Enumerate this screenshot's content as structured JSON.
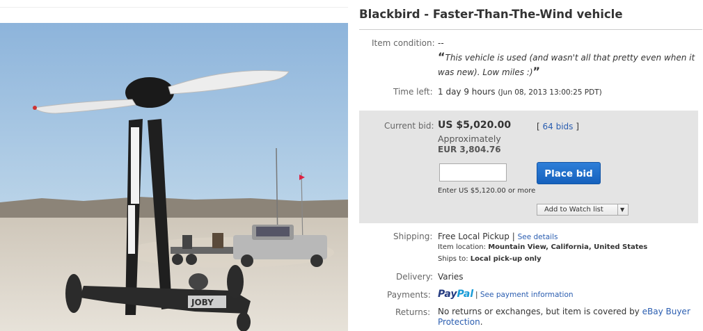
{
  "listing": {
    "title": "Blackbird - Faster-Than-The-Wind vehicle"
  },
  "condition": {
    "label": "Item condition:",
    "value": "--",
    "quote_open": "“",
    "quote_text": "This vehicle is used (and wasn't all that pretty even when it was new). Low miles :)",
    "quote_close": "”"
  },
  "time_left": {
    "label": "Time left:",
    "value": "1 day 9 hours",
    "end_date": "(Jun 08, 2013  13:00:25 PDT)"
  },
  "bid": {
    "label": "Current bid:",
    "price": "US $5,020.00",
    "bids_open": "[ ",
    "bids_count": "64 bids",
    "bids_close": " ]",
    "approx_label": "Approximately",
    "approx_value": "EUR 3,804.76",
    "input_value": "",
    "place_bid_label": "Place bid",
    "enter_hint": "Enter US $5,120.00 or more",
    "watch_label": "Add to Watch list",
    "watch_caret": "▼"
  },
  "shipping": {
    "label": "Shipping:",
    "value": "Free Local Pickup",
    "sep": " | ",
    "details_link": "See details",
    "location_label": "Item location:",
    "location_value": "Mountain View, California, United States",
    "ships_to_label": "Ships to:",
    "ships_to_value": "Local pick-up only"
  },
  "delivery": {
    "label": "Delivery:",
    "value": "Varies"
  },
  "payments": {
    "label": "Payments:",
    "paypal_a": "Pay",
    "paypal_b": "Pal",
    "info_sep": "| ",
    "info_link": "See payment information"
  },
  "returns": {
    "label": "Returns:",
    "text": "No returns or exchanges, but item is covered by ",
    "link": "eBay Buyer Protection",
    "end": "."
  },
  "photo": {
    "alt_logo": "JOBY"
  },
  "colors": {
    "link": "#2a5db0",
    "button": "#1561bd",
    "bidbox": "#e4e4e4"
  }
}
